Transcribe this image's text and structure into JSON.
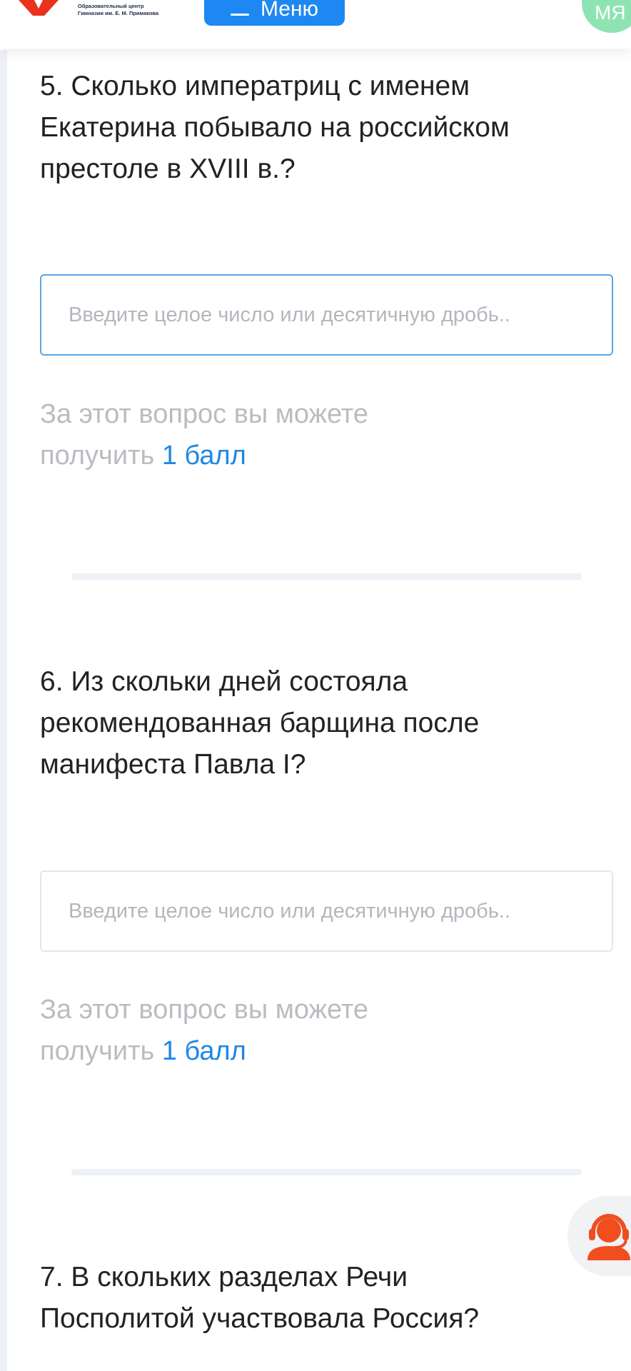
{
  "header": {
    "logo_line1": "Образовательный центр",
    "logo_line2": "Гимназии им. Е. М. Примакова",
    "menu_label": "Меню",
    "avatar_text": "МЯ"
  },
  "questions": [
    {
      "title": "5. Сколько императриц с именем Екатерина побывало на российском престоле в XVIII в.?",
      "placeholder": "Введите целое число или десятичную дробь..",
      "score_prefix": "За этот вопрос вы можете получить",
      "score_value": "1 балл"
    },
    {
      "title": "6. Из скольки дней состояла рекомендованная барщина после манифеста Павла I?",
      "placeholder": "Введите целое число или десятичную дробь..",
      "score_prefix": "За этот вопрос вы можете получить",
      "score_value": "1 балл"
    },
    {
      "title": "7. В скольких разделах Речи Посполитой участвовала Россия?"
    }
  ],
  "colors": {
    "accent": "#1e88f2",
    "score_highlight": "#1e88e5",
    "support_icon": "#f04e1e",
    "avatar": "#8fe3b2",
    "logo": "#e8321e"
  },
  "icons": {
    "menu": "hamburger-icon",
    "support": "headset-operator-icon",
    "logo": "red-v-logo-icon"
  }
}
